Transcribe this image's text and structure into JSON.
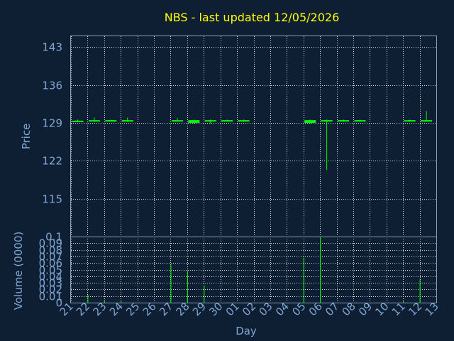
{
  "chart_data": [
    {
      "type": "candlestick",
      "title": "NBS - last updated 12/05/2026",
      "ylabel": "Price",
      "ylim": [
        108,
        145
      ],
      "yticks": [
        115,
        122,
        129,
        136,
        143
      ],
      "grid": true,
      "color": "#00ff00",
      "ohlc": [
        {
          "x": 0,
          "open": 129.4,
          "high": 129.6,
          "low": 129.2,
          "close": 129.4
        },
        {
          "x": 1,
          "open": 129.4,
          "high": 130.0,
          "low": 129.2,
          "close": 129.5
        },
        {
          "x": 2,
          "open": 129.5,
          "high": 129.6,
          "low": 129.2,
          "close": 129.4
        },
        {
          "x": 3,
          "open": 129.4,
          "high": 130.0,
          "low": 129.2,
          "close": 129.5
        },
        {
          "x": 6,
          "open": 129.4,
          "high": 129.9,
          "low": 129.2,
          "close": 129.5
        },
        {
          "x": 7,
          "open": 129.0,
          "high": 129.6,
          "low": 128.9,
          "close": 129.5
        },
        {
          "x": 8,
          "open": 129.4,
          "high": 129.6,
          "low": 128.9,
          "close": 129.5
        },
        {
          "x": 9,
          "open": 129.4,
          "high": 129.6,
          "low": 129.2,
          "close": 129.5
        },
        {
          "x": 10,
          "open": 129.4,
          "high": 129.6,
          "low": 129.2,
          "close": 129.5
        },
        {
          "x": 14,
          "open": 129.0,
          "high": 129.6,
          "low": 128.9,
          "close": 129.5
        },
        {
          "x": 15,
          "open": 129.4,
          "high": 129.6,
          "low": 120.3,
          "close": 129.5
        },
        {
          "x": 16,
          "open": 129.4,
          "high": 129.6,
          "low": 129.2,
          "close": 129.5
        },
        {
          "x": 17,
          "open": 129.4,
          "high": 129.6,
          "low": 129.2,
          "close": 129.5
        },
        {
          "x": 20,
          "open": 129.4,
          "high": 129.6,
          "low": 129.2,
          "close": 129.5
        },
        {
          "x": 21,
          "open": 129.4,
          "high": 131.2,
          "low": 129.2,
          "close": 129.5
        }
      ]
    },
    {
      "type": "bar",
      "ylabel": "Volume (0000)",
      "xlabel": "Day",
      "ylim": [
        0,
        0.1
      ],
      "yticks": [
        "0",
        "0.01",
        "0.02",
        "0.03",
        "0.04",
        "0.05",
        "0.06",
        "0.07",
        "0.08",
        "0.09",
        "0.1"
      ],
      "grid": true,
      "color": "#00ff00",
      "categories": [
        "21",
        "22",
        "23",
        "24",
        "25",
        "26",
        "27",
        "28",
        "29",
        "30",
        "01",
        "02",
        "03",
        "04",
        "05",
        "06",
        "07",
        "08",
        "09",
        "10",
        "11",
        "12",
        "13"
      ],
      "values": [
        {
          "x": 1,
          "value": 0.012
        },
        {
          "x": 2,
          "value": 0.004
        },
        {
          "x": 3,
          "value": 0.003
        },
        {
          "x": 6,
          "value": 0.058
        },
        {
          "x": 7,
          "value": 0.049
        },
        {
          "x": 8,
          "value": 0.026
        },
        {
          "x": 14,
          "value": 0.068
        },
        {
          "x": 15,
          "value": 0.1
        },
        {
          "x": 20,
          "value": 0.003
        },
        {
          "x": 21,
          "value": 0.035
        }
      ]
    }
  ]
}
